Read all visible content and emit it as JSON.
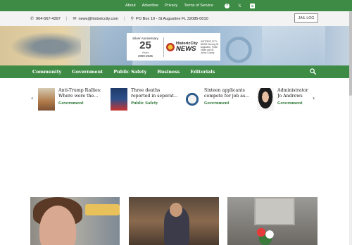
{
  "topbar": {
    "links": [
      "About",
      "Advertise",
      "Privacy",
      "Terms of Service"
    ],
    "social": [
      {
        "name": "facebook-icon",
        "glyph": "f"
      },
      {
        "name": "x-icon",
        "glyph": "𝕏"
      },
      {
        "name": "linkedin-icon",
        "glyph": "in"
      }
    ]
  },
  "contact": {
    "phone": "904-567-4397",
    "email": "news@historiccity.com",
    "address": "PO Box 10 - St Augustine FL 32085-0010",
    "jail_button": "JAIL LOG"
  },
  "hero": {
    "anniversary": {
      "line1": "Silver Anniversary",
      "number": "25",
      "years": "Years",
      "dates": "2000-2025"
    },
    "brand_top": "HistoricCity",
    "brand_news": "NEWS",
    "tagline": "HISTORIC CITY NEWS Serving St. Augustine, Ponte Vedra and St. Johns County"
  },
  "nav": {
    "items": [
      "Community",
      "Government",
      "Public Safety",
      "Business",
      "Editorials"
    ]
  },
  "ticker": {
    "cards": [
      {
        "title": "Anti-Trump Rallies: Where were the...",
        "category": "Government"
      },
      {
        "title": "Three deaths reported in seperat...",
        "category": "Public Safety"
      },
      {
        "title": "Sixteen applicants compete for job as...",
        "category": "Government"
      },
      {
        "title": "Administrator Jo Andrews back on",
        "category": "Government"
      }
    ]
  },
  "colors": {
    "brand_green": "#3e8b45",
    "category_green": "#2f7a3a"
  }
}
